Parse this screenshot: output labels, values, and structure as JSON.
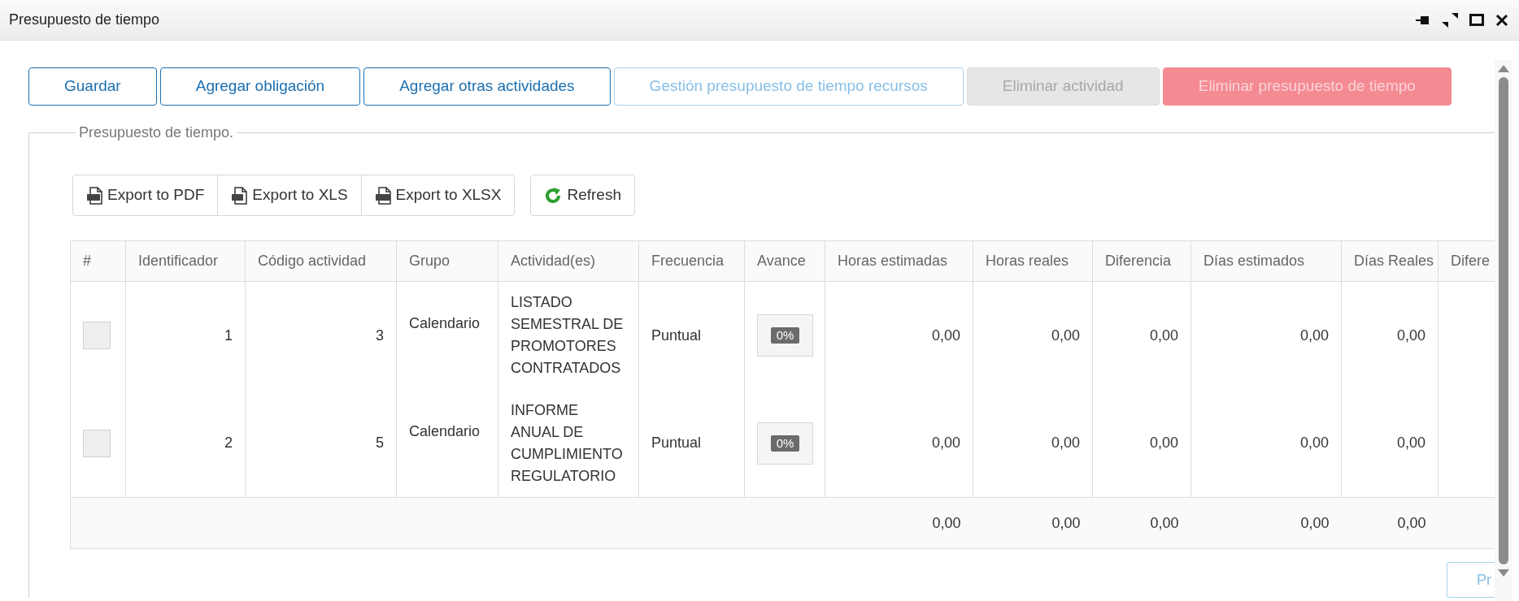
{
  "window": {
    "title": "Presupuesto de tiempo"
  },
  "actions": [
    {
      "label": "Guardar",
      "kind": "outline",
      "disabled": false
    },
    {
      "label": "Agregar obligación",
      "kind": "outline",
      "disabled": false
    },
    {
      "label": "Agregar otras actividades",
      "kind": "outline",
      "disabled": false
    },
    {
      "label": "Gestión presupuesto de tiempo recursos",
      "kind": "outline",
      "disabled": true
    },
    {
      "label": "Eliminar actividad",
      "kind": "secondary",
      "disabled": true
    },
    {
      "label": "Eliminar presupuesto de tiempo",
      "kind": "danger",
      "disabled": true
    }
  ],
  "section": {
    "legend": "Presupuesto de tiempo.",
    "toolbar": [
      {
        "label": "Export to PDF",
        "kind": "pdf"
      },
      {
        "label": "Export to XLS",
        "kind": "xls"
      },
      {
        "label": "Export to XLSX",
        "kind": "xlsx"
      }
    ],
    "refresh": {
      "label": "Refresh"
    },
    "table": {
      "columns": [
        "#",
        "Identificador",
        "Código actividad",
        "Grupo",
        "Actividad(es)",
        "Frecuencia",
        "Avance",
        "Horas estimadas",
        "Horas reales",
        "Diferencia",
        "Días estimados",
        "Días Reales",
        "Difere"
      ],
      "rows": [
        {
          "checked": false,
          "id": "1",
          "code": "3",
          "group": "Calendario",
          "activity": "LISTADO SEMESTRAL DE PROMOTORES CONTRATADOS",
          "frequency": "Puntual",
          "progress": {
            "text": "0%",
            "level": 0
          },
          "values": [
            "0,00",
            "0,00",
            "0,00",
            "0,00",
            "0,00"
          ]
        },
        {
          "checked": false,
          "id": "2",
          "code": "5",
          "group": "Calendario",
          "activity": "INFORME ANUAL DE CUMPLIMIENTO REGULATORIO",
          "frequency": "Puntual",
          "progress": {
            "text": "0%",
            "level": 0
          },
          "values": [
            "0,00",
            "0,00",
            "0,00",
            "0,00",
            "0,00"
          ]
        }
      ],
      "totals": [
        "0,00",
        "0,00",
        "0,00",
        "0,00",
        "0,00"
      ]
    },
    "pager_button": {
      "label": "Pr"
    }
  }
}
